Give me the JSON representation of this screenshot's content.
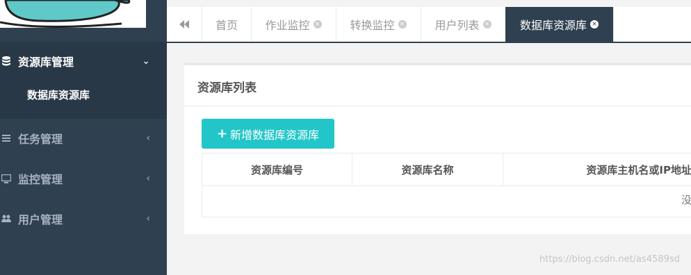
{
  "sidebar": {
    "items": [
      {
        "label": "资源库管理",
        "icon": "database-icon",
        "arrow": "⌄",
        "open": true
      },
      {
        "label": "任务管理",
        "icon": "list-icon",
        "arrow": "‹"
      },
      {
        "label": "监控管理",
        "icon": "desktop-icon",
        "arrow": "‹"
      },
      {
        "label": "用户管理",
        "icon": "users-icon",
        "arrow": "‹"
      }
    ],
    "sub_item": "数据库资源库"
  },
  "tabs": [
    {
      "label": "首页",
      "closable": false
    },
    {
      "label": "作业监控",
      "closable": true
    },
    {
      "label": "转换监控",
      "closable": true
    },
    {
      "label": "用户列表",
      "closable": true
    },
    {
      "label": "数据库资源库",
      "closable": true,
      "active": true
    }
  ],
  "panel": {
    "title": "资源库列表",
    "add_button": "新增数据库资源库",
    "columns": [
      "资源库编号",
      "资源库名称",
      "资源库主机名或IP地址"
    ],
    "empty_text": "没"
  },
  "colors": {
    "sidebar_bg": "#2f4050",
    "accent": "#23c6c8"
  },
  "watermark": "https://blog.csdn.net/as4589sd"
}
